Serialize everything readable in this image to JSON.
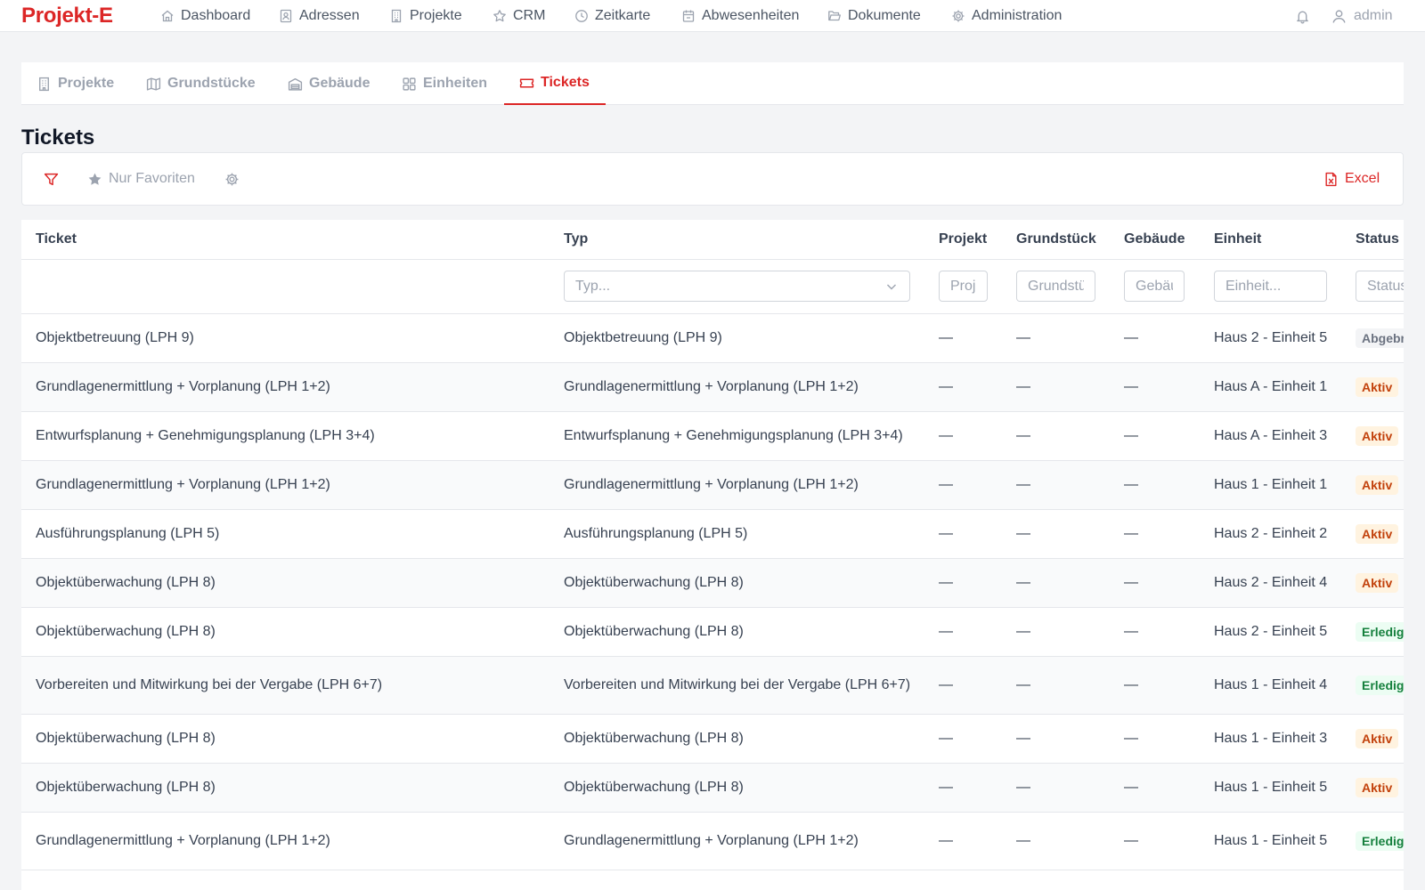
{
  "app": {
    "brand": "Projekt-E"
  },
  "nav": {
    "items": [
      {
        "label": "Dashboard",
        "icon": "home-icon"
      },
      {
        "label": "Adressen",
        "icon": "address-book-icon"
      },
      {
        "label": "Projekte",
        "icon": "building-icon"
      },
      {
        "label": "CRM",
        "icon": "star-icon"
      },
      {
        "label": "Zeitkarte",
        "icon": "clock-icon"
      },
      {
        "label": "Abwesenheiten",
        "icon": "calendar-icon"
      },
      {
        "label": "Dokumente",
        "icon": "folder-icon"
      },
      {
        "label": "Administration",
        "icon": "gear-icon"
      }
    ],
    "user": "admin"
  },
  "tabs": [
    {
      "label": "Projekte",
      "icon": "building-icon",
      "active": false
    },
    {
      "label": "Grundstücke",
      "icon": "map-icon",
      "active": false
    },
    {
      "label": "Gebäude",
      "icon": "warehouse-icon",
      "active": false
    },
    {
      "label": "Einheiten",
      "icon": "grid-icon",
      "active": false
    },
    {
      "label": "Tickets",
      "icon": "ticket-icon",
      "active": true
    }
  ],
  "page": {
    "title": "Tickets"
  },
  "toolbar": {
    "favorites_label": "Nur Favoriten",
    "excel_label": "Excel"
  },
  "table": {
    "columns": [
      "Ticket",
      "Typ",
      "Projekt",
      "Grundstück",
      "Gebäude",
      "Einheit",
      "Status"
    ],
    "filters": {
      "typ_placeholder": "Typ...",
      "projekt_placeholder": "Projekt...",
      "grundstueck_placeholder": "Grundstück...",
      "gebaeude_placeholder": "Gebäude...",
      "einheit_placeholder": "Einheit...",
      "status_placeholder": "Status..."
    },
    "rows": [
      {
        "ticket": "Objektbetreuung (LPH 9)",
        "typ": "Objektbetreuung (LPH 9)",
        "projekt": "—",
        "grundstueck": "—",
        "gebaeude": "—",
        "einheit": "Haus 2 - Einheit 5",
        "status": "Abgebrochen",
        "status_key": "abgebrochen"
      },
      {
        "ticket": "Grundlagenermittlung + Vorplanung (LPH 1+2)",
        "typ": "Grundlagenermittlung + Vorplanung (LPH 1+2)",
        "projekt": "—",
        "grundstueck": "—",
        "gebaeude": "—",
        "einheit": "Haus A - Einheit 1",
        "status": "Aktiv",
        "status_key": "aktiv"
      },
      {
        "ticket": "Entwurfsplanung + Genehmigungsplanung (LPH 3+4)",
        "typ": "Entwurfsplanung + Genehmigungsplanung (LPH 3+4)",
        "projekt": "—",
        "grundstueck": "—",
        "gebaeude": "—",
        "einheit": "Haus A - Einheit 3",
        "status": "Aktiv",
        "status_key": "aktiv"
      },
      {
        "ticket": "Grundlagenermittlung + Vorplanung (LPH 1+2)",
        "typ": "Grundlagenermittlung + Vorplanung (LPH 1+2)",
        "projekt": "—",
        "grundstueck": "—",
        "gebaeude": "—",
        "einheit": "Haus 1 - Einheit 1",
        "status": "Aktiv",
        "status_key": "aktiv"
      },
      {
        "ticket": "Ausführungsplanung (LPH 5)",
        "typ": "Ausführungsplanung (LPH 5)",
        "projekt": "—",
        "grundstueck": "—",
        "gebaeude": "—",
        "einheit": "Haus 2 - Einheit 2",
        "status": "Aktiv",
        "status_key": "aktiv"
      },
      {
        "ticket": "Objektüberwachung (LPH 8)",
        "typ": "Objektüberwachung (LPH 8)",
        "projekt": "—",
        "grundstueck": "—",
        "gebaeude": "—",
        "einheit": "Haus 2 - Einheit 4",
        "status": "Aktiv",
        "status_key": "aktiv"
      },
      {
        "ticket": "Objektüberwachung (LPH 8)",
        "typ": "Objektüberwachung (LPH 8)",
        "projekt": "—",
        "grundstueck": "—",
        "gebaeude": "—",
        "einheit": "Haus 2 - Einheit 5",
        "status": "Erledigt",
        "status_key": "erledigt"
      },
      {
        "ticket": "Vorbereiten und Mitwirkung bei der Vergabe (LPH 6+7)",
        "typ": "Vorbereiten und Mitwirkung bei der Vergabe (LPH 6+7)",
        "projekt": "—",
        "grundstueck": "—",
        "gebaeude": "—",
        "einheit": "Haus 1 - Einheit 4",
        "status": "Erledigt",
        "status_key": "erledigt"
      },
      {
        "ticket": "Objektüberwachung (LPH 8)",
        "typ": "Objektüberwachung (LPH 8)",
        "projekt": "—",
        "grundstueck": "—",
        "gebaeude": "—",
        "einheit": "Haus 1 - Einheit 3",
        "status": "Aktiv",
        "status_key": "aktiv"
      },
      {
        "ticket": "Objektüberwachung (LPH 8)",
        "typ": "Objektüberwachung (LPH 8)",
        "projekt": "—",
        "grundstueck": "—",
        "gebaeude": "—",
        "einheit": "Haus 1 - Einheit 5",
        "status": "Aktiv",
        "status_key": "aktiv"
      },
      {
        "ticket": "Grundlagenermittlung + Vorplanung (LPH 1+2)",
        "typ": "Grundlagenermittlung + Vorplanung (LPH 1+2)",
        "projekt": "—",
        "grundstueck": "—",
        "gebaeude": "—",
        "einheit": "Haus 1 - Einheit 5",
        "status": "Erledigt",
        "status_key": "erledigt"
      }
    ]
  }
}
